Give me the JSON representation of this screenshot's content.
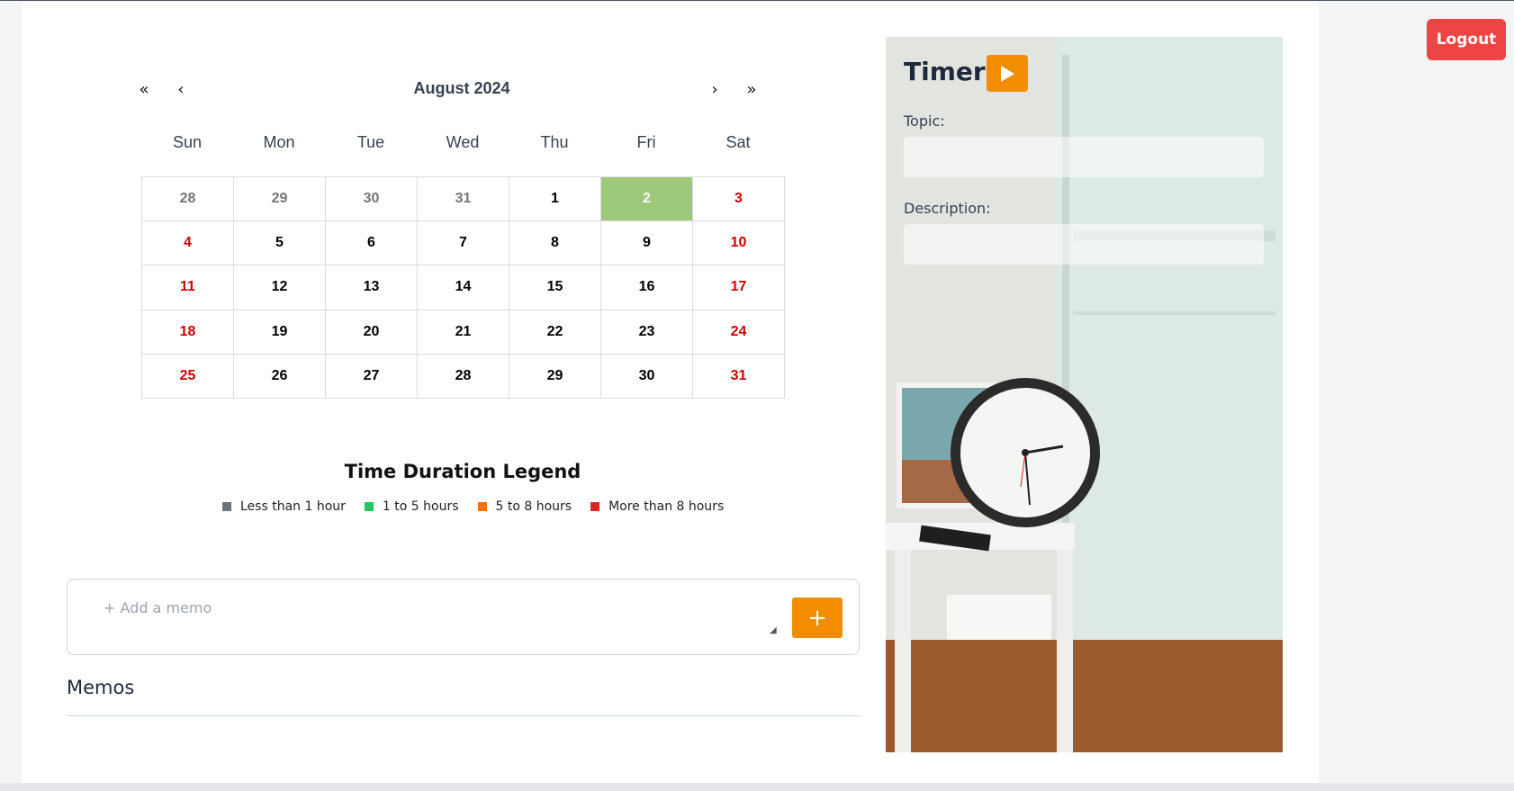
{
  "header": {
    "logout_label": "Logout"
  },
  "calendar": {
    "month_label": "August 2024",
    "nav": {
      "prev_year": "«",
      "prev_month": "‹",
      "next_month": "›",
      "next_year": "»"
    },
    "weekdays": [
      "Sun",
      "Mon",
      "Tue",
      "Wed",
      "Thu",
      "Fri",
      "Sat"
    ],
    "days": [
      {
        "label": "28",
        "kind": "other"
      },
      {
        "label": "29",
        "kind": "other"
      },
      {
        "label": "30",
        "kind": "other"
      },
      {
        "label": "31",
        "kind": "other"
      },
      {
        "label": "1",
        "kind": "normal"
      },
      {
        "label": "2",
        "kind": "today"
      },
      {
        "label": "3",
        "kind": "weekend"
      },
      {
        "label": "4",
        "kind": "weekend"
      },
      {
        "label": "5",
        "kind": "normal"
      },
      {
        "label": "6",
        "kind": "normal"
      },
      {
        "label": "7",
        "kind": "normal"
      },
      {
        "label": "8",
        "kind": "normal"
      },
      {
        "label": "9",
        "kind": "normal"
      },
      {
        "label": "10",
        "kind": "weekend"
      },
      {
        "label": "11",
        "kind": "weekend"
      },
      {
        "label": "12",
        "kind": "normal"
      },
      {
        "label": "13",
        "kind": "normal"
      },
      {
        "label": "14",
        "kind": "normal"
      },
      {
        "label": "15",
        "kind": "normal"
      },
      {
        "label": "16",
        "kind": "normal"
      },
      {
        "label": "17",
        "kind": "weekend"
      },
      {
        "label": "18",
        "kind": "weekend"
      },
      {
        "label": "19",
        "kind": "normal"
      },
      {
        "label": "20",
        "kind": "normal"
      },
      {
        "label": "21",
        "kind": "normal"
      },
      {
        "label": "22",
        "kind": "normal"
      },
      {
        "label": "23",
        "kind": "normal"
      },
      {
        "label": "24",
        "kind": "weekend"
      },
      {
        "label": "25",
        "kind": "weekend"
      },
      {
        "label": "26",
        "kind": "normal"
      },
      {
        "label": "27",
        "kind": "normal"
      },
      {
        "label": "28",
        "kind": "normal"
      },
      {
        "label": "29",
        "kind": "normal"
      },
      {
        "label": "30",
        "kind": "normal"
      },
      {
        "label": "31",
        "kind": "weekend"
      }
    ],
    "colors": {
      "today": "#9ec97a",
      "weekend": "#d10000",
      "other_month": "#757575"
    }
  },
  "legend": {
    "title": "Time Duration Legend",
    "items": [
      {
        "label": "Less than 1 hour",
        "color": "#6b7280"
      },
      {
        "label": "1 to 5 hours",
        "color": "#22c55e"
      },
      {
        "label": "5 to 8 hours",
        "color": "#f97316"
      },
      {
        "label": "More than 8 hours",
        "color": "#dc2626"
      }
    ]
  },
  "memo": {
    "placeholder": "+ Add a memo",
    "add_label": "+",
    "section_title": "Memos"
  },
  "timer": {
    "title": "Timer",
    "play_icon": "play-icon",
    "topic_label": "Topic:",
    "topic_value": "",
    "description_label": "Description:",
    "description_value": "",
    "accent_color": "#f28c00"
  }
}
